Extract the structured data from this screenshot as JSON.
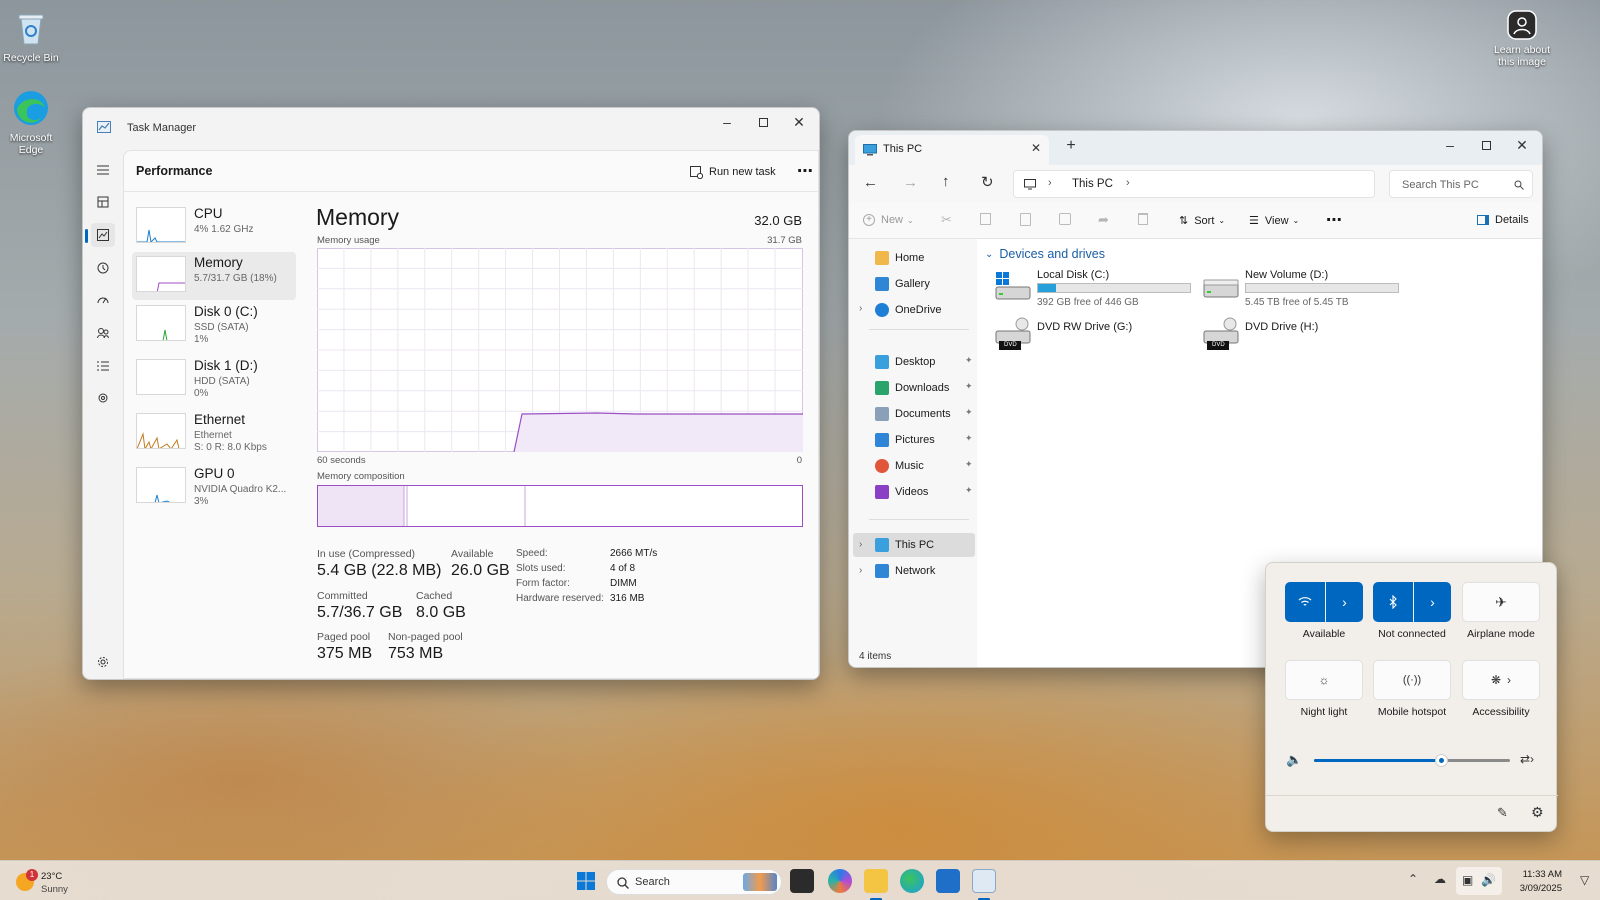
{
  "desktop": {
    "recycle_bin": "Recycle Bin",
    "edge": "Microsoft Edge",
    "learn_about_image": "Learn about this image"
  },
  "task_manager": {
    "title": "Task Manager",
    "section_title": "Performance",
    "run_new_task": "Run new task",
    "perf_items": [
      {
        "name": "CPU",
        "sub1": "4% 1.62 GHz",
        "sub2": ""
      },
      {
        "name": "Memory",
        "sub1": "5.7/31.7 GB (18%)",
        "sub2": ""
      },
      {
        "name": "Disk 0 (C:)",
        "sub1": "SSD (SATA)",
        "sub2": "1%"
      },
      {
        "name": "Disk 1 (D:)",
        "sub1": "HDD (SATA)",
        "sub2": "0%"
      },
      {
        "name": "Ethernet",
        "sub1": "Ethernet",
        "sub2": "S: 0 R: 8.0 Kbps"
      },
      {
        "name": "GPU 0",
        "sub1": "NVIDIA Quadro K2...",
        "sub2": "3%"
      }
    ],
    "memory": {
      "heading": "Memory",
      "total": "32.0 GB",
      "usage_label": "Memory usage",
      "usage_max": "31.7 GB",
      "time_left": "60 seconds",
      "time_right": "0",
      "composition_label": "Memory composition",
      "in_use_label": "In use (Compressed)",
      "in_use_value": "5.4 GB (22.8 MB)",
      "available_label": "Available",
      "available_value": "26.0 GB",
      "committed_label": "Committed",
      "committed_value": "5.7/36.7 GB",
      "cached_label": "Cached",
      "cached_value": "8.0 GB",
      "paged_label": "Paged pool",
      "paged_value": "375 MB",
      "nonpaged_label": "Non-paged pool",
      "nonpaged_value": "753 MB",
      "speed_label": "Speed:",
      "speed_value": "2666 MT/s",
      "slots_label": "Slots used:",
      "slots_value": "4 of 8",
      "form_label": "Form factor:",
      "form_value": "DIMM",
      "hwres_label": "Hardware reserved:",
      "hwres_value": "316 MB"
    }
  },
  "explorer": {
    "tab_title": "This PC",
    "breadcrumb": "This PC",
    "search_placeholder": "Search This PC",
    "toolbar": {
      "new": "New",
      "sort": "Sort",
      "view": "View",
      "details": "Details"
    },
    "nav": {
      "home": "Home",
      "gallery": "Gallery",
      "onedrive": "OneDrive",
      "desktop": "Desktop",
      "downloads": "Downloads",
      "documents": "Documents",
      "pictures": "Pictures",
      "music": "Music",
      "videos": "Videos",
      "this_pc": "This PC",
      "network": "Network"
    },
    "group_title": "Devices and drives",
    "drives": [
      {
        "name": "Local Disk (C:)",
        "free": "392 GB free of 446 GB",
        "used_fraction": 0.12
      },
      {
        "name": "New Volume (D:)",
        "free": "5.45 TB free of 5.45 TB",
        "used_fraction": 0.0
      },
      {
        "name": "DVD RW Drive (G:)",
        "badge": "DVD"
      },
      {
        "name": "DVD Drive (H:)",
        "badge": "DVD"
      }
    ],
    "status": "4 items"
  },
  "quick_settings": {
    "wifi_label": "Available",
    "bluetooth_label": "Not connected",
    "airplane_label": "Airplane mode",
    "night_light_label": "Night light",
    "hotspot_label": "Mobile hotspot",
    "accessibility_label": "Accessibility",
    "volume_level": 0.65
  },
  "taskbar": {
    "temperature": "23°C",
    "condition": "Sunny",
    "weather_badge": "1",
    "search": "Search",
    "time": "11:33 AM",
    "date": "3/09/2025"
  },
  "colors": {
    "accent": "#0067c0",
    "memory_purple": "#9b4ec5"
  }
}
